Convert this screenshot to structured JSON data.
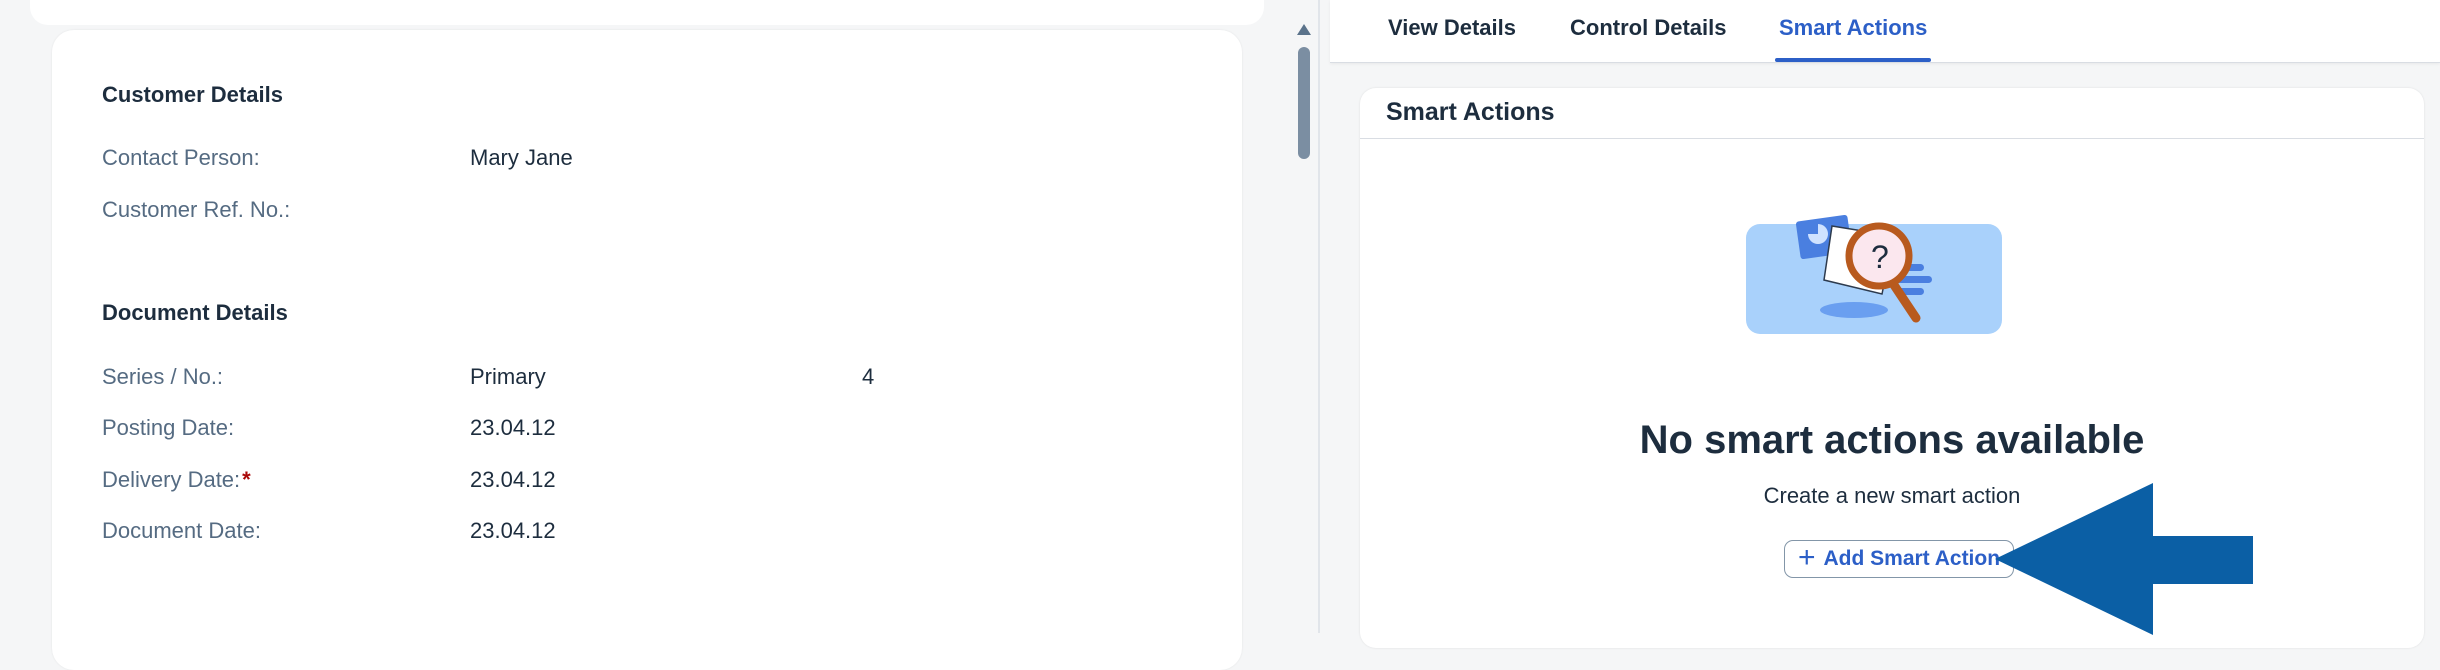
{
  "customer_details": {
    "title": "Customer Details",
    "contact_person_label": "Contact Person:",
    "contact_person_value": "Mary Jane",
    "customer_ref_label": "Customer Ref. No.:"
  },
  "document_details": {
    "title": "Document Details",
    "series_label": "Series / No.:",
    "series_value": "Primary",
    "series_number": "4",
    "posting_date_label": "Posting Date:",
    "posting_date_value": "23.04.12",
    "delivery_date_label": "Delivery Date:",
    "delivery_date_required": "*",
    "delivery_date_value": "23.04.12",
    "document_date_label": "Document Date:",
    "document_date_value": "23.04.12"
  },
  "tabs": [
    {
      "label": "View Details"
    },
    {
      "label": "Control Details"
    },
    {
      "label": "Smart Actions",
      "active": true
    }
  ],
  "smart_actions": {
    "title": "Smart Actions",
    "empty_title": "No smart actions available",
    "empty_subtitle": "Create a new smart action",
    "add_button_label": "Add Smart Action",
    "add_icon": "plus-icon"
  },
  "colors": {
    "accent": "#2c5fc7",
    "arrow": "#0b5fa5",
    "required": "#aa0808"
  }
}
